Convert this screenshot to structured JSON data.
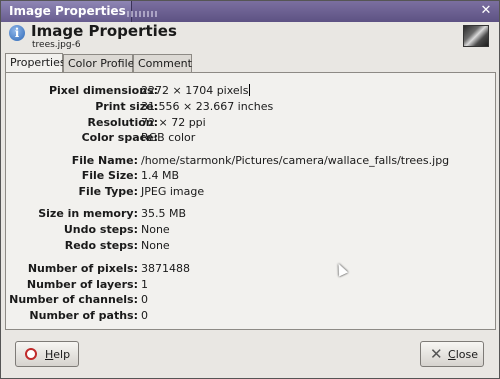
{
  "window": {
    "title": "Image Properties"
  },
  "header": {
    "title": "Image Properties",
    "subtitle": "trees.jpg-6"
  },
  "tabs": [
    {
      "label": "Properties",
      "active": true
    },
    {
      "label": "Color Profile",
      "active": false
    },
    {
      "label": "Comment",
      "active": false
    }
  ],
  "properties": {
    "pixel_dimensions": {
      "label": "Pixel dimensions:",
      "value": "2272 × 1704 pixels"
    },
    "print_size": {
      "label": "Print size:",
      "value": "31.556 × 23.667 inches"
    },
    "resolution": {
      "label": "Resolution:",
      "value": "72 × 72 ppi"
    },
    "color_space": {
      "label": "Color space:",
      "value": "RGB color"
    },
    "file_name": {
      "label": "File Name:",
      "value": "/home/starmonk/Pictures/camera/wallace_falls/trees.jpg"
    },
    "file_size": {
      "label": "File Size:",
      "value": "1.4 MB"
    },
    "file_type": {
      "label": "File Type:",
      "value": "JPEG image"
    },
    "size_in_memory": {
      "label": "Size in memory:",
      "value": "35.5 MB"
    },
    "undo_steps": {
      "label": "Undo steps:",
      "value": "None"
    },
    "redo_steps": {
      "label": "Redo steps:",
      "value": "None"
    },
    "number_of_pixels": {
      "label": "Number of pixels:",
      "value": "3871488"
    },
    "number_of_layers": {
      "label": "Number of layers:",
      "value": "1"
    },
    "number_of_channels": {
      "label": "Number of channels:",
      "value": "0"
    },
    "number_of_paths": {
      "label": "Number of paths:",
      "value": "0"
    }
  },
  "buttons": {
    "help": {
      "label_first": "H",
      "label_rest": "elp"
    },
    "close": {
      "label_first": "C",
      "label_rest": "lose"
    }
  },
  "icons": {
    "info": "info-icon",
    "help": "lifebuoy-icon",
    "close": "close-x-icon"
  }
}
